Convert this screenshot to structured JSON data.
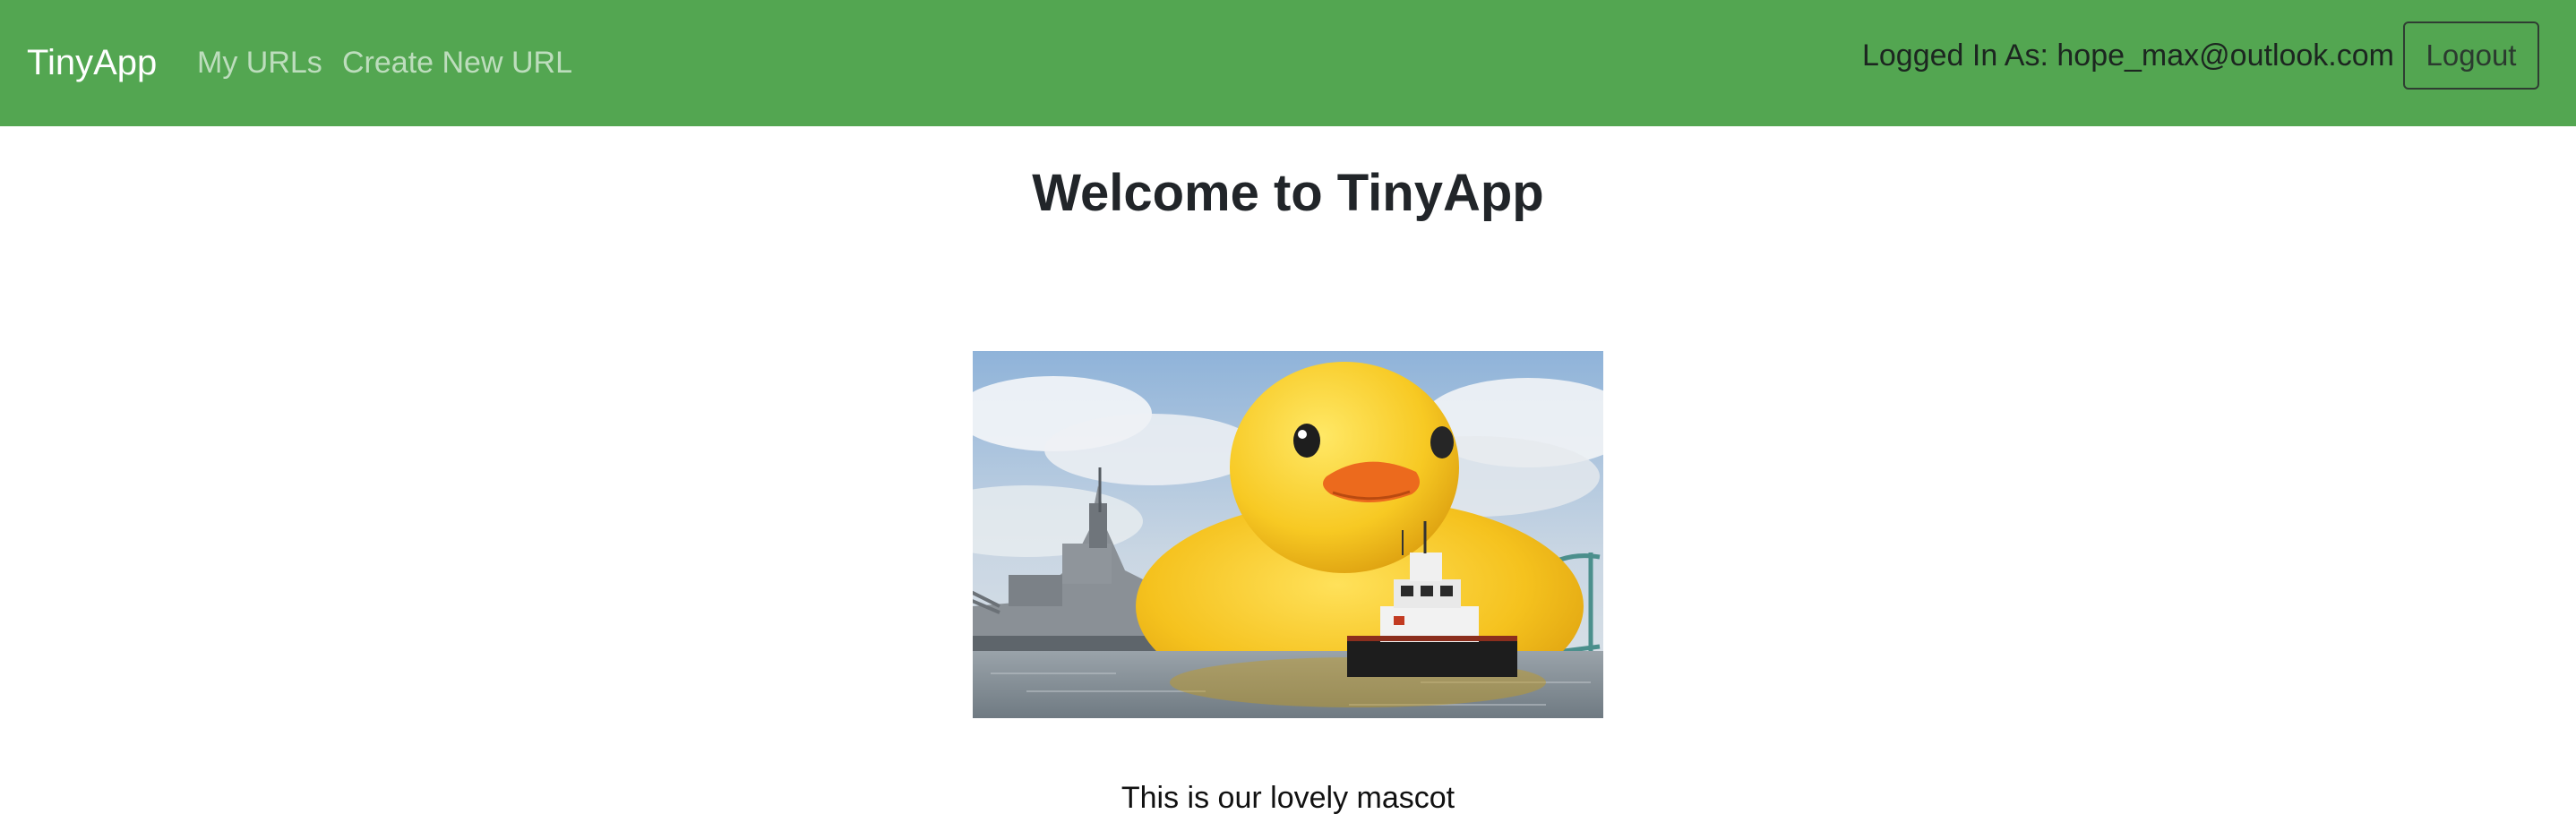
{
  "navbar": {
    "brand": "TinyApp",
    "links": [
      {
        "label": "My URLs"
      },
      {
        "label": "Create New URL"
      }
    ],
    "logged_in_text": "Logged In As: hope_max@outlook.com",
    "logout_label": "Logout",
    "background_color": "#53a651"
  },
  "main": {
    "title": "Welcome to TinyApp",
    "mascot_caption": "This is our lovely mascot"
  }
}
